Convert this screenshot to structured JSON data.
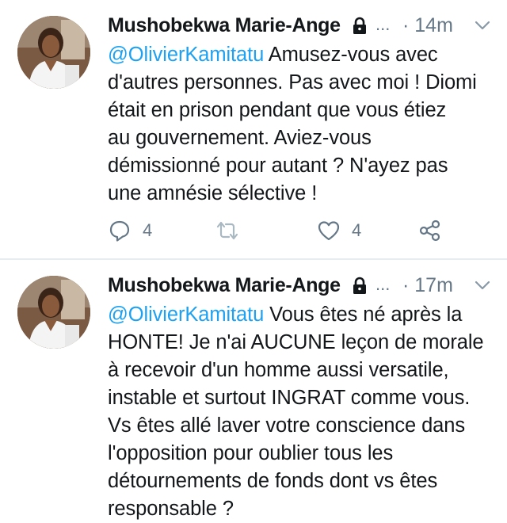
{
  "tweets": [
    {
      "author": "Mushobekwa Marie-Ange",
      "ellipsis": "...",
      "time": "· 14m",
      "mention": "@OlivierKamitatu",
      "first_line_rest": " Amusez-vous avec",
      "lines": [
        "d'autres personnes. Pas avec moi ! Diomi",
        "était en prison pendant que vous étiez",
        "au gouvernement. Aviez-vous",
        "démissionné pour autant ? N'ayez pas",
        "une amnésie sélective !"
      ],
      "reply_count": "4",
      "like_count": "4"
    },
    {
      "author": "Mushobekwa Marie-Ange",
      "ellipsis": "...",
      "time": "· 17m",
      "mention": "@OlivierKamitatu",
      "first_line_rest": " Vous êtes né après la",
      "lines": [
        "HONTE! Je n'ai AUCUNE leçon de morale",
        "à recevoir d'un homme aussi versatile,",
        "instable et surtout INGRAT comme vous.",
        "Vs êtes allé laver votre conscience dans",
        "l'opposition pour oublier tous les",
        "détournements de fonds dont vs êtes",
        "responsable ?"
      ]
    }
  ],
  "colors": {
    "text": "#14171a",
    "muted": "#657786",
    "link": "#1da1f2",
    "divider": "#e6ecf0"
  },
  "icons": [
    "avatar",
    "lock-icon",
    "chevron-down-icon",
    "reply-icon",
    "retweet-icon",
    "like-icon",
    "share-icon"
  ]
}
